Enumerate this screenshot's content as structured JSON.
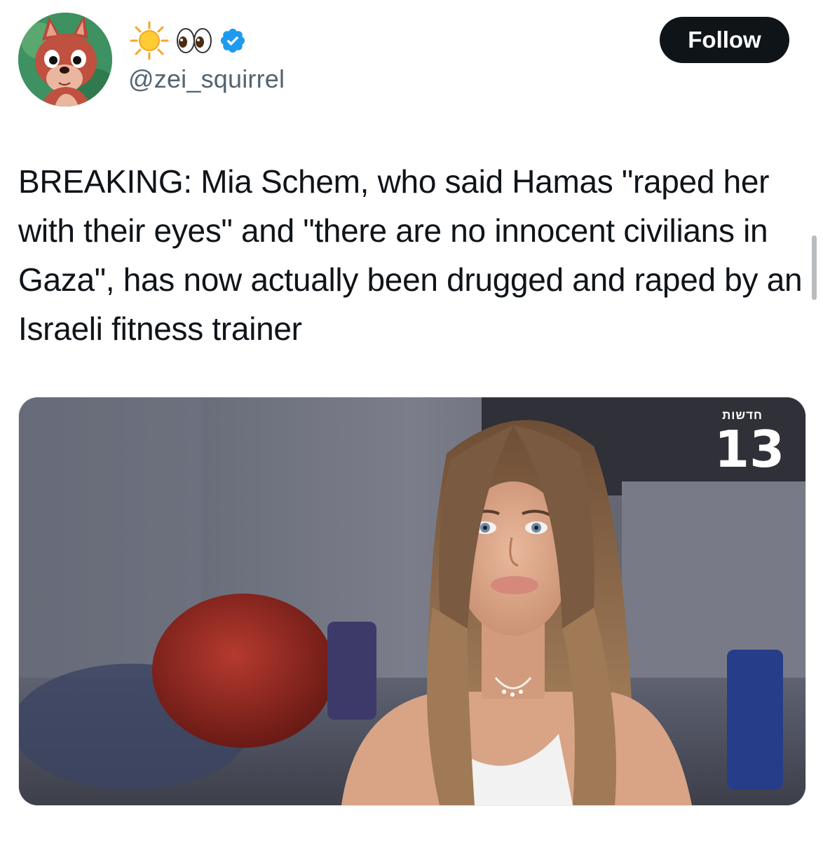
{
  "author": {
    "display_emoji": [
      "sun-emoji",
      "eyes-emoji"
    ],
    "handle": "@zei_squirrel",
    "verified": true,
    "avatar": "squirrel-avatar"
  },
  "follow_button": {
    "label": "Follow"
  },
  "tweet": {
    "text": "BREAKING: Mia Schem, who said Hamas \"raped her with their eyes\" and \"there are no innocent civilians in Gaza\", has now actually been drugged and raped by an Israeli fitness trainer"
  },
  "media": {
    "channel_label": "חדשות",
    "channel_number": "13"
  },
  "colors": {
    "verified_blue": "#1d9bf0",
    "follow_bg": "#0f1419",
    "handle_gray": "#536471",
    "text": "#0f1419"
  }
}
